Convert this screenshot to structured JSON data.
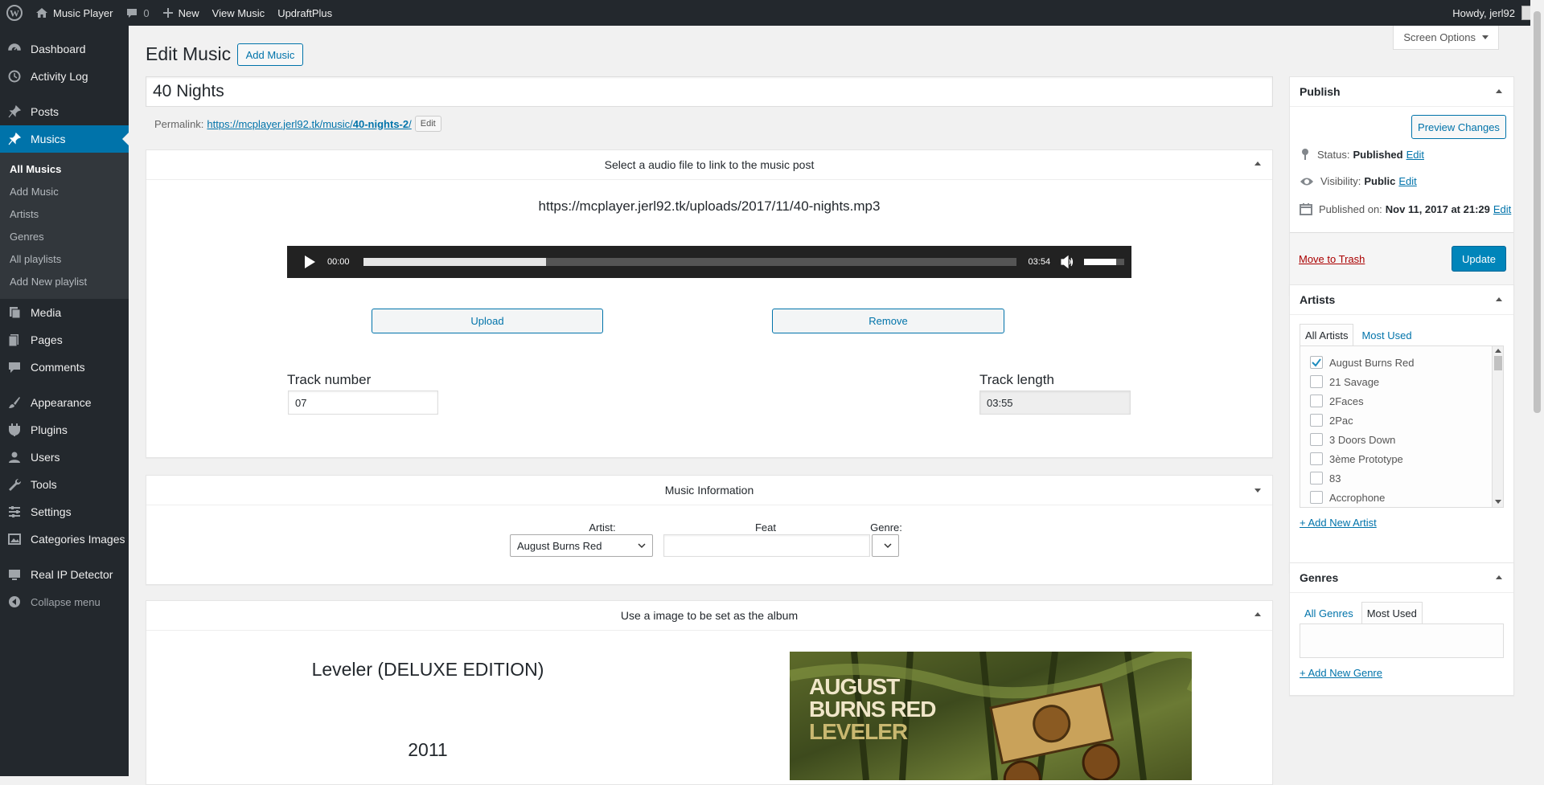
{
  "adminbar": {
    "site_name": "Music Player",
    "comments_count": "0",
    "new_label": "New",
    "view_label": "View Music",
    "updraft_label": "UpdraftPlus",
    "howdy": "Howdy, jerl92"
  },
  "sidebar": {
    "items": [
      {
        "label": "Dashboard",
        "icon": "dashboard-icon"
      },
      {
        "label": "Activity Log",
        "icon": "history-icon"
      },
      {
        "label": "Posts",
        "icon": "pin-icon"
      },
      {
        "label": "Musics",
        "icon": "pin-icon"
      },
      {
        "label": "Media",
        "icon": "media-icon"
      },
      {
        "label": "Pages",
        "icon": "pages-icon"
      },
      {
        "label": "Comments",
        "icon": "comments-icon"
      },
      {
        "label": "Appearance",
        "icon": "brush-icon"
      },
      {
        "label": "Plugins",
        "icon": "plugin-icon"
      },
      {
        "label": "Users",
        "icon": "users-icon"
      },
      {
        "label": "Tools",
        "icon": "wrench-icon"
      },
      {
        "label": "Settings",
        "icon": "settings-icon"
      },
      {
        "label": "Categories Images",
        "icon": "image-icon"
      },
      {
        "label": "Real IP Detector",
        "icon": "monitor-icon"
      }
    ],
    "submenu": [
      "All Musics",
      "Add Music",
      "Artists",
      "Genres",
      "All playlists",
      "Add New playlist"
    ],
    "collapse": "Collapse menu"
  },
  "header": {
    "title": "Edit Music",
    "add_button": "Add Music",
    "screen_options": "Screen Options"
  },
  "post": {
    "title": "40 Nights",
    "permalink_label": "Permalink:",
    "permalink_base": "https://mcplayer.jerl92.tk/music/",
    "permalink_slug": "40-nights-2",
    "permalink_trail": "/",
    "permalink_edit": "Edit"
  },
  "audio_box": {
    "heading": "Select a audio file to link to the music post",
    "file_url": "https://mcplayer.jerl92.tk/uploads/2017/11/40-nights.mp3",
    "current_time": "00:00",
    "duration": "03:54",
    "buffered_fraction": 0.28,
    "volume_fraction": 0.8,
    "upload_label": "Upload",
    "remove_label": "Remove",
    "track_number_label": "Track number",
    "track_number": "07",
    "track_length_label": "Track length",
    "track_length": "03:55"
  },
  "music_info": {
    "heading": "Music Information",
    "artist_label": "Artist:",
    "artist_value": "August Burns Red",
    "feat_label": "Feat",
    "feat_value": "",
    "genre_label": "Genre:"
  },
  "album_box": {
    "heading": "Use a image to be set as the album",
    "album_title": "Leveler (DELUXE EDITION)",
    "year": "2011",
    "cover_lines": [
      "AUGUST",
      "BURNS RED",
      "LEVELER"
    ]
  },
  "publish": {
    "heading": "Publish",
    "preview_label": "Preview Changes",
    "status_label": "Status:",
    "status_value": "Published",
    "visibility_label": "Visibility:",
    "visibility_value": "Public",
    "published_label": "Published on:",
    "published_value": "Nov 11, 2017 at 21:29",
    "edit_label": "Edit",
    "trash_label": "Move to Trash",
    "update_label": "Update"
  },
  "artists_box": {
    "heading": "Artists",
    "tab_all": "All Artists",
    "tab_most": "Most Used",
    "items": [
      {
        "label": "August Burns Red",
        "checked": true
      },
      {
        "label": "21 Savage",
        "checked": false
      },
      {
        "label": "2Faces",
        "checked": false
      },
      {
        "label": "2Pac",
        "checked": false
      },
      {
        "label": "3 Doors Down",
        "checked": false
      },
      {
        "label": "3ème Prototype",
        "checked": false
      },
      {
        "label": "83",
        "checked": false
      },
      {
        "label": "Accrophone",
        "checked": false
      }
    ],
    "add_new": "+ Add New Artist"
  },
  "genres_box": {
    "heading": "Genres",
    "tab_all": "All Genres",
    "tab_most": "Most Used",
    "add_new": "+ Add New Genre"
  },
  "colors": {
    "accent": "#0073aa",
    "admin_dark": "#23282d",
    "update_blue": "#0085ba",
    "trash_red": "#a00"
  }
}
